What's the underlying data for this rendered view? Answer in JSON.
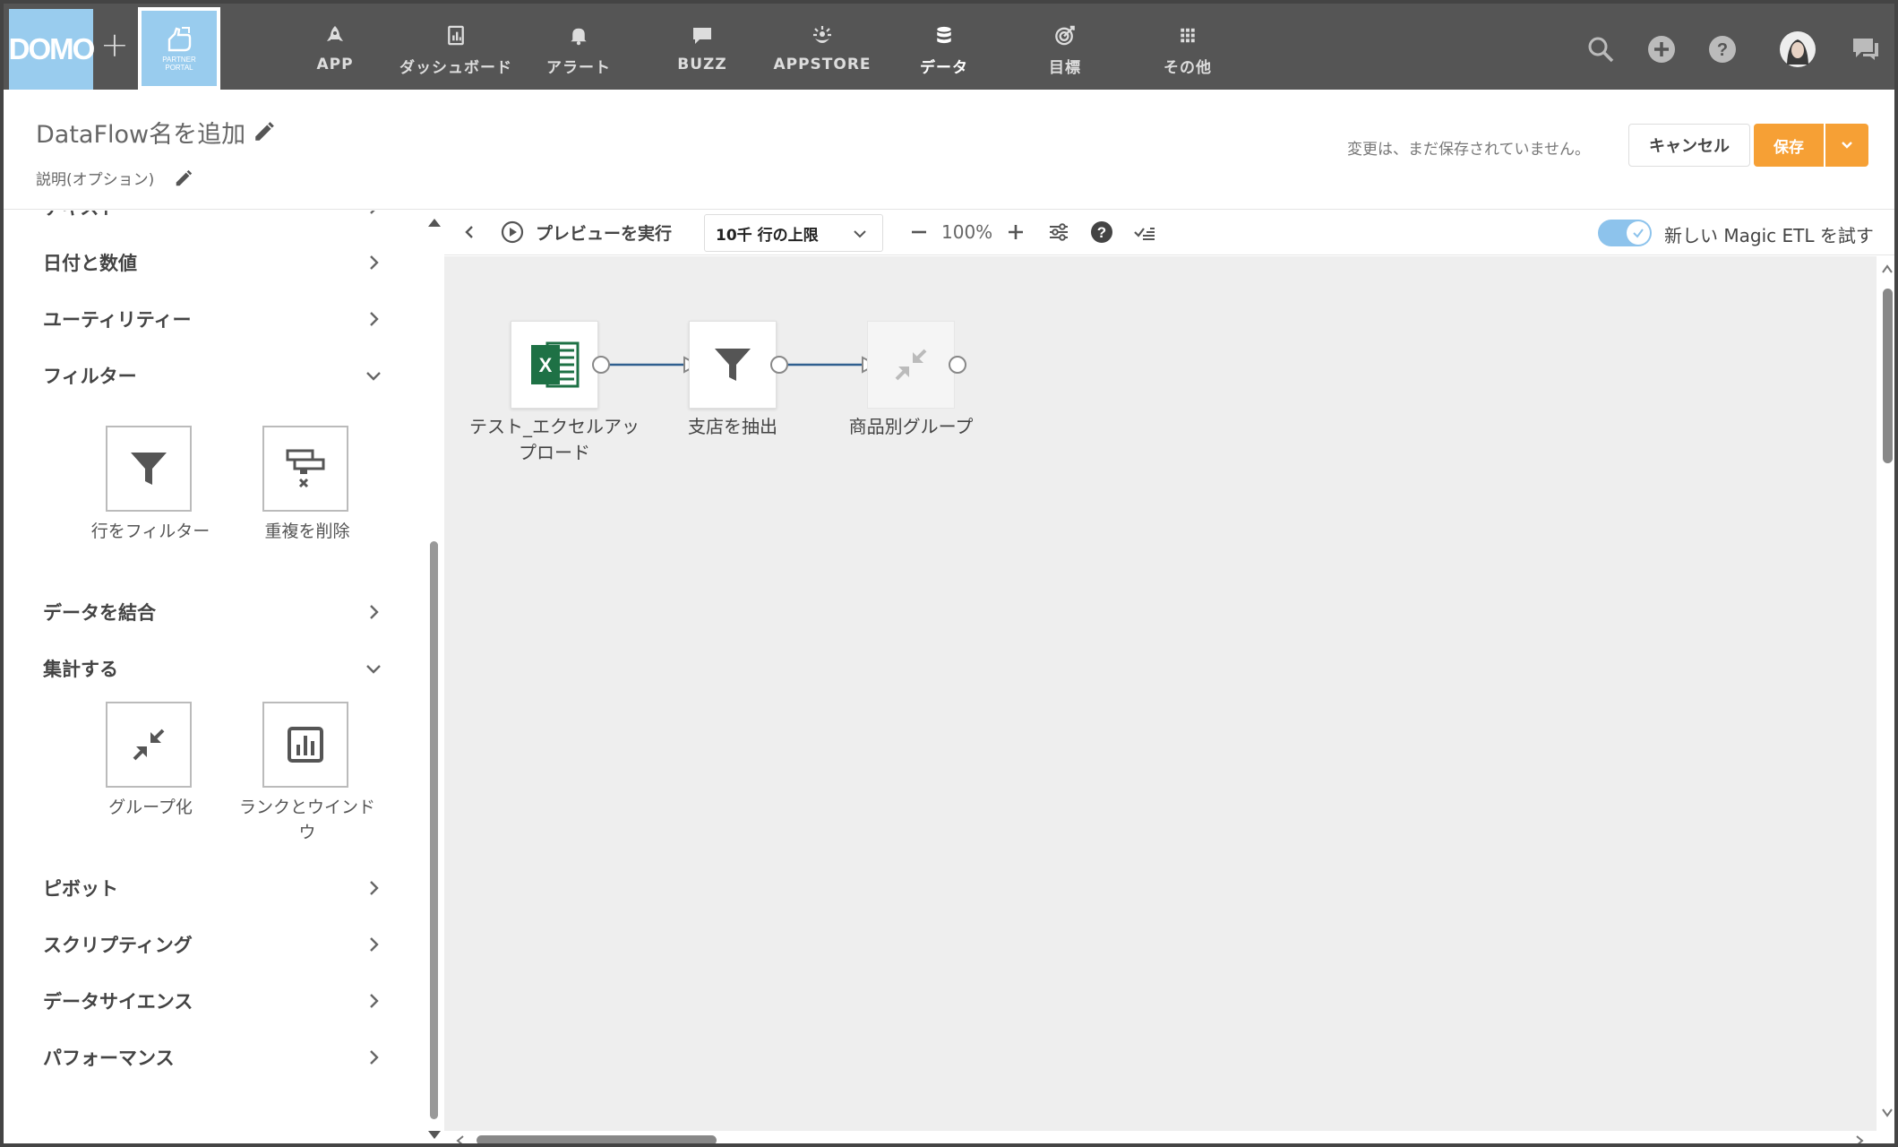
{
  "topnav": {
    "logo": "DOMO",
    "plus": "+",
    "partner_label": "PARTNER\nPORTAL",
    "items": [
      {
        "label": "APP",
        "icon": "rocket-icon"
      },
      {
        "label": "ダッシュボード",
        "icon": "dashboard-icon"
      },
      {
        "label": "アラート",
        "icon": "bell-icon"
      },
      {
        "label": "BUZZ",
        "icon": "chat-icon"
      },
      {
        "label": "APPSTORE",
        "icon": "appstore-icon"
      },
      {
        "label": "データ",
        "icon": "database-icon"
      },
      {
        "label": "目標",
        "icon": "target-icon"
      },
      {
        "label": "その他",
        "icon": "grid-icon"
      }
    ],
    "active_item": "データ",
    "right_icons": [
      "search-icon",
      "add-circle-icon",
      "help-icon",
      "avatar",
      "chat-bubble-icon"
    ]
  },
  "header": {
    "title": "DataFlow名を追加",
    "description": "説明(オプション)",
    "unsaved_text": "変更は、まだ保存されていません。",
    "cancel_label": "キャンセル",
    "save_label": "保存"
  },
  "sidebar": {
    "partial_top": "テキスト",
    "categories": [
      {
        "label": "日付と数値",
        "state": "collapsed"
      },
      {
        "label": "ユーティリティー",
        "state": "collapsed"
      },
      {
        "label": "フィルター",
        "state": "expanded"
      },
      {
        "label": "データを結合",
        "state": "collapsed"
      },
      {
        "label": "集計する",
        "state": "expanded"
      },
      {
        "label": "ピボット",
        "state": "collapsed"
      },
      {
        "label": "スクリプティング",
        "state": "collapsed"
      },
      {
        "label": "データサイエンス",
        "state": "collapsed"
      },
      {
        "label": "パフォーマンス",
        "state": "collapsed"
      }
    ],
    "filter_tiles": [
      {
        "label": "行をフィルター",
        "icon": "funnel-icon"
      },
      {
        "label": "重複を削除",
        "icon": "remove-duplicates-icon"
      }
    ],
    "aggregate_tiles": [
      {
        "label": "グループ化",
        "icon": "group-by-icon"
      },
      {
        "label": "ランクとウインドウ",
        "icon": "rank-window-icon"
      }
    ]
  },
  "toolbar": {
    "run_preview": "プレビューを実行",
    "row_limit": "10千 行の上限",
    "zoom": "100%",
    "toggle_label": "新しい Magic ETL を試す",
    "toggle_on": true
  },
  "canvas": {
    "nodes": [
      {
        "label": "テスト_エクセルアップロード",
        "icon": "excel-icon"
      },
      {
        "label": "支店を抽出",
        "icon": "funnel-icon"
      },
      {
        "label": "商品別グループ",
        "icon": "group-by-icon"
      }
    ],
    "connector_color": "#2f5f8f"
  },
  "colors": {
    "nav_bg": "#555555",
    "logo_bg": "#99ccee",
    "save_orange": "#f6a035",
    "canvas_bg": "#eeeeee",
    "toggle_blue": "#8dc3ec",
    "excel_green": "#1e7145"
  }
}
